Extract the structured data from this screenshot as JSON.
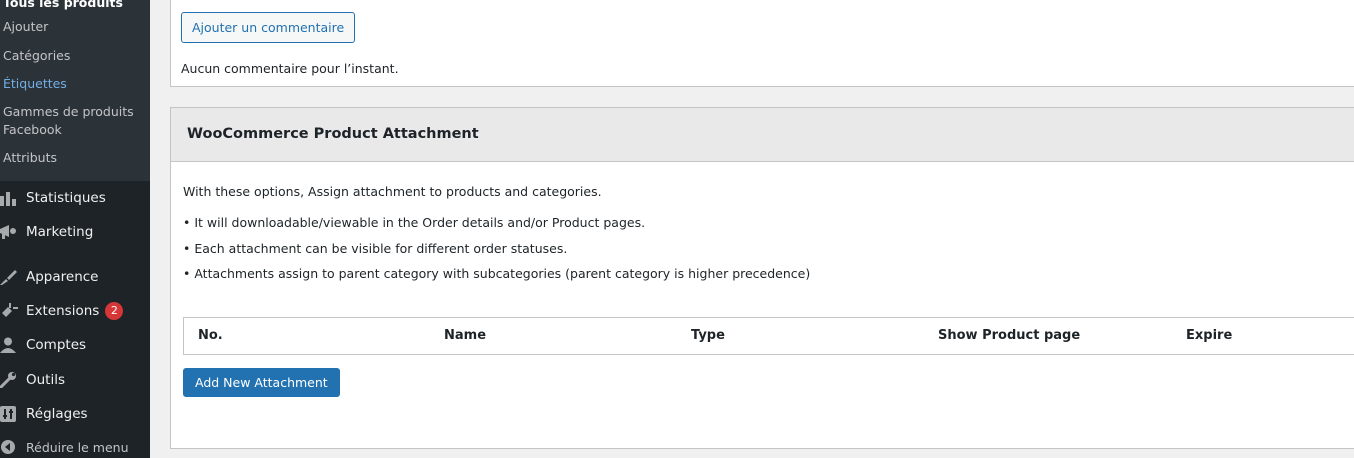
{
  "sidebar": {
    "submenu": [
      {
        "label": "Tous les produits"
      },
      {
        "label": "Ajouter"
      },
      {
        "label": "Catégories"
      },
      {
        "label": "Étiquettes"
      },
      {
        "label": "Gammes de produits"
      },
      {
        "label": "Facebook"
      },
      {
        "label": "Attributs"
      }
    ],
    "menu": [
      {
        "label": "Statistiques",
        "icon": "bar-chart-icon"
      },
      {
        "label": "Marketing",
        "icon": "megaphone-icon"
      },
      {
        "label": "Apparence",
        "icon": "paintbrush-icon"
      },
      {
        "label": "Extensions",
        "icon": "plugin-icon",
        "badge": "2"
      },
      {
        "label": "Comptes",
        "icon": "user-icon"
      },
      {
        "label": "Outils",
        "icon": "wrench-icon"
      },
      {
        "label": "Réglages",
        "icon": "settings-sliders-icon"
      },
      {
        "label": "Réduire le menu",
        "icon": "collapse-arrow-icon"
      }
    ]
  },
  "comments": {
    "add_button": "Ajouter un commentaire",
    "empty_text": "Aucun commentaire pour l’instant."
  },
  "attachment_box": {
    "title": "WooCommerce Product Attachment",
    "intro": "With these options, Assign attachment to products and categories.",
    "bullets": [
      "• It will downloadable/viewable in the Order details and/or Product pages.",
      "• Each attachment can be visible for different order statuses.",
      "• Attachments assign to parent category with subcategories (parent category is higher precedence)"
    ],
    "table_headers": [
      "No.",
      "Name",
      "Type",
      "Show Product page",
      "Expire"
    ],
    "add_button": "Add New Attachment"
  },
  "colors": {
    "sidebar_bg": "#1d2327",
    "submenu_bg": "#2c3338",
    "accent": "#2271b1",
    "active_link": "#72aee6",
    "badge": "#d63638"
  }
}
